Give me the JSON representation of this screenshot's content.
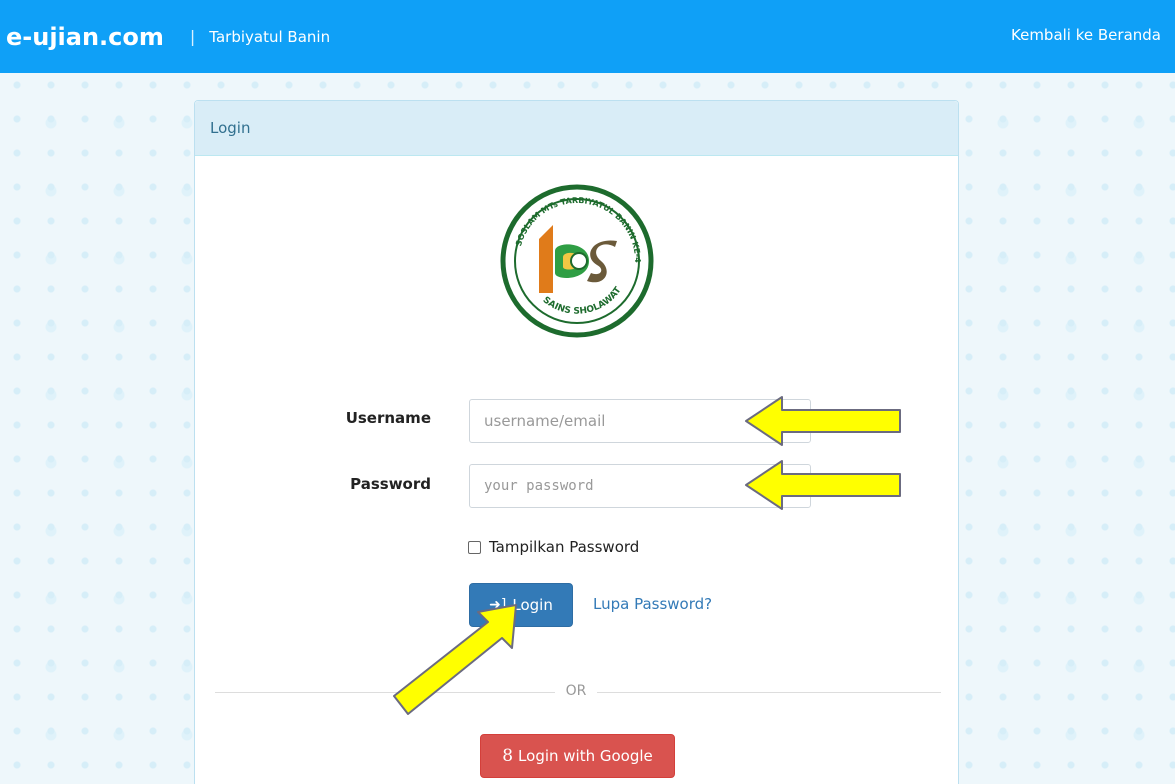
{
  "header": {
    "brand": "e-ujian.com",
    "separator": "|",
    "school_name": "Tarbiyatul Banin",
    "home_link": "Kembali ke Beranda"
  },
  "panel": {
    "title": "Login"
  },
  "logo": {
    "ring_text_top": "SOSLAM MTs TARBIYATUL BANIN KE-48",
    "ring_text_bottom": "SAINS SHOLAWAT",
    "initials": "tbS"
  },
  "form": {
    "username_label": "Username",
    "username_placeholder": "username/email",
    "password_label": "Password",
    "password_placeholder": "your password",
    "show_password_label": "Tampilkan Password",
    "show_password_checked": false,
    "login_button": "Login",
    "forgot_link": "Lupa Password?",
    "or_text": "OR",
    "google_button": "Login with Google",
    "google_icon_glyph": "8"
  },
  "colors": {
    "topbar": "#0fa0f7",
    "panel_head": "#d9edf7",
    "login_button": "#337ab7",
    "google_button": "#d9534f",
    "annotation_arrow": "#ffff00"
  },
  "annotations": {
    "arrow_icons": [
      "arrow-left-icon",
      "arrow-left-icon",
      "arrow-up-left-icon"
    ]
  }
}
